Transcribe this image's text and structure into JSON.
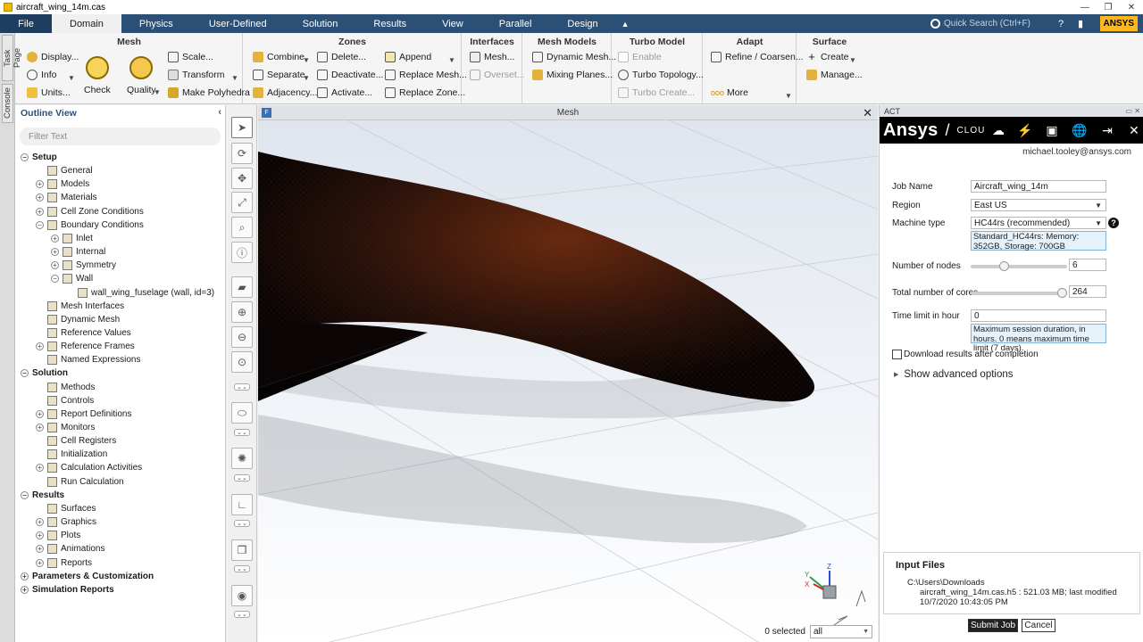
{
  "window": {
    "title": "aircraft_wing_14m.cas"
  },
  "menubar": {
    "file": "File",
    "tabs": [
      "Domain",
      "Physics",
      "User-Defined",
      "Solution",
      "Results",
      "View",
      "Parallel",
      "Design"
    ],
    "active_tab": "Domain",
    "search_placeholder": "Quick Search (Ctrl+F)",
    "logo": "ANSYS"
  },
  "ribbon": {
    "mesh": {
      "title": "Mesh",
      "display": "Display...",
      "info": "Info",
      "units": "Units...",
      "check": "Check",
      "quality": "Quality",
      "scale": "Scale...",
      "transform": "Transform",
      "make_polyhedra": "Make Polyhedra"
    },
    "zones": {
      "title": "Zones",
      "combine": "Combine",
      "separate": "Separate",
      "adjacency": "Adjacency...",
      "delete": "Delete...",
      "deactivate": "Deactivate...",
      "activate": "Activate...",
      "append": "Append",
      "replace_mesh": "Replace Mesh...",
      "replace_zone": "Replace Zone..."
    },
    "interfaces": {
      "title": "Interfaces",
      "mesh": "Mesh...",
      "overset": "Overset..."
    },
    "mesh_models": {
      "title": "Mesh Models",
      "dynamic_mesh": "Dynamic Mesh...",
      "mixing_planes": "Mixing Planes..."
    },
    "turbo_model": {
      "title": "Turbo Model",
      "enable": "Enable",
      "turbo_topology": "Turbo Topology...",
      "turbo_create": "Turbo Create..."
    },
    "adapt": {
      "title": "Adapt",
      "refine": "Refine / Coarsen...",
      "more": "More"
    },
    "surface": {
      "title": "Surface",
      "create": "Create",
      "manage": "Manage..."
    }
  },
  "leftstrip": {
    "task_page": "Task Page",
    "console": "Console"
  },
  "outline": {
    "title": "Outline View",
    "filter_placeholder": "Filter Text",
    "items": [
      {
        "label": "Setup",
        "depth": 0,
        "toggle": "−",
        "bold": true,
        "icon": false
      },
      {
        "label": "General",
        "depth": 1,
        "toggle": "",
        "bold": false,
        "icon": true
      },
      {
        "label": "Models",
        "depth": 1,
        "toggle": "+",
        "bold": false,
        "icon": true
      },
      {
        "label": "Materials",
        "depth": 1,
        "toggle": "+",
        "bold": false,
        "icon": true
      },
      {
        "label": "Cell Zone Conditions",
        "depth": 1,
        "toggle": "+",
        "bold": false,
        "icon": true
      },
      {
        "label": "Boundary Conditions",
        "depth": 1,
        "toggle": "−",
        "bold": false,
        "icon": true
      },
      {
        "label": "Inlet",
        "depth": 2,
        "toggle": "+",
        "bold": false,
        "icon": true
      },
      {
        "label": "Internal",
        "depth": 2,
        "toggle": "+",
        "bold": false,
        "icon": true
      },
      {
        "label": "Symmetry",
        "depth": 2,
        "toggle": "+",
        "bold": false,
        "icon": true
      },
      {
        "label": "Wall",
        "depth": 2,
        "toggle": "−",
        "bold": false,
        "icon": true
      },
      {
        "label": "wall_wing_fuselage (wall, id=3)",
        "depth": 3,
        "toggle": "",
        "bold": false,
        "icon": true
      },
      {
        "label": "Mesh Interfaces",
        "depth": 1,
        "toggle": "",
        "bold": false,
        "icon": true
      },
      {
        "label": "Dynamic Mesh",
        "depth": 1,
        "toggle": "",
        "bold": false,
        "icon": true
      },
      {
        "label": "Reference Values",
        "depth": 1,
        "toggle": "",
        "bold": false,
        "icon": true
      },
      {
        "label": "Reference Frames",
        "depth": 1,
        "toggle": "+",
        "bold": false,
        "icon": true
      },
      {
        "label": "Named Expressions",
        "depth": 1,
        "toggle": "",
        "bold": false,
        "icon": true
      },
      {
        "label": "Solution",
        "depth": 0,
        "toggle": "−",
        "bold": true,
        "icon": false
      },
      {
        "label": "Methods",
        "depth": 1,
        "toggle": "",
        "bold": false,
        "icon": true
      },
      {
        "label": "Controls",
        "depth": 1,
        "toggle": "",
        "bold": false,
        "icon": true
      },
      {
        "label": "Report Definitions",
        "depth": 1,
        "toggle": "+",
        "bold": false,
        "icon": true
      },
      {
        "label": "Monitors",
        "depth": 1,
        "toggle": "+",
        "bold": false,
        "icon": true
      },
      {
        "label": "Cell Registers",
        "depth": 1,
        "toggle": "",
        "bold": false,
        "icon": true
      },
      {
        "label": "Initialization",
        "depth": 1,
        "toggle": "",
        "bold": false,
        "icon": true
      },
      {
        "label": "Calculation Activities",
        "depth": 1,
        "toggle": "+",
        "bold": false,
        "icon": true
      },
      {
        "label": "Run Calculation",
        "depth": 1,
        "toggle": "",
        "bold": false,
        "icon": true
      },
      {
        "label": "Results",
        "depth": 0,
        "toggle": "−",
        "bold": true,
        "icon": false
      },
      {
        "label": "Surfaces",
        "depth": 1,
        "toggle": "",
        "bold": false,
        "icon": true
      },
      {
        "label": "Graphics",
        "depth": 1,
        "toggle": "+",
        "bold": false,
        "icon": true
      },
      {
        "label": "Plots",
        "depth": 1,
        "toggle": "+",
        "bold": false,
        "icon": true
      },
      {
        "label": "Animations",
        "depth": 1,
        "toggle": "+",
        "bold": false,
        "icon": true
      },
      {
        "label": "Reports",
        "depth": 1,
        "toggle": "+",
        "bold": false,
        "icon": true
      },
      {
        "label": "Parameters & Customization",
        "depth": 0,
        "toggle": "+",
        "bold": true,
        "icon": false
      },
      {
        "label": "Simulation Reports",
        "depth": 0,
        "toggle": "+",
        "bold": true,
        "icon": false
      }
    ]
  },
  "viewport": {
    "title": "Mesh",
    "selected_label": "0 selected",
    "filter_value": "all",
    "axes": {
      "x": "X",
      "y": "Y",
      "z": "Z"
    }
  },
  "act": {
    "header": "ACT",
    "brand": "Ansys",
    "brand_suffix": "CLOU",
    "user_email": "michael.tooley@ansys.com",
    "job_name_label": "Job Name",
    "job_name": "Aircraft_wing_14m",
    "region_label": "Region",
    "region": "East US",
    "machine_type_label": "Machine type",
    "machine_type": "HC44rs (recommended)",
    "machine_note": "Standard_HC44rs: Memory: 352GB, Storage: 700GB",
    "nodes_label": "Number of nodes",
    "nodes": "6",
    "nodes_fraction": 0.33,
    "cores_label": "Total number of cores",
    "cores": "264",
    "cores_fraction": 1.0,
    "time_label": "Time limit in hour",
    "time_limit": "0",
    "time_note": "Maximum session duration, in hours. 0 means maximum time limit (7 days).",
    "download_label": "Download results after completion",
    "advanced_label": "Show advanced options",
    "input_files_title": "Input Files",
    "input_path": "C:\\Users\\Downloads",
    "input_file": "aircraft_wing_14m.cas.h5 : 521.03 MB; last modified 10/7/2020 10:43:05 PM",
    "submit_label": "Submit Job",
    "cancel_label": "Cancel"
  },
  "colors": {
    "menubar": "#2b4f75",
    "accent": "#ffb71b",
    "mesh": "#1a0e0a"
  }
}
